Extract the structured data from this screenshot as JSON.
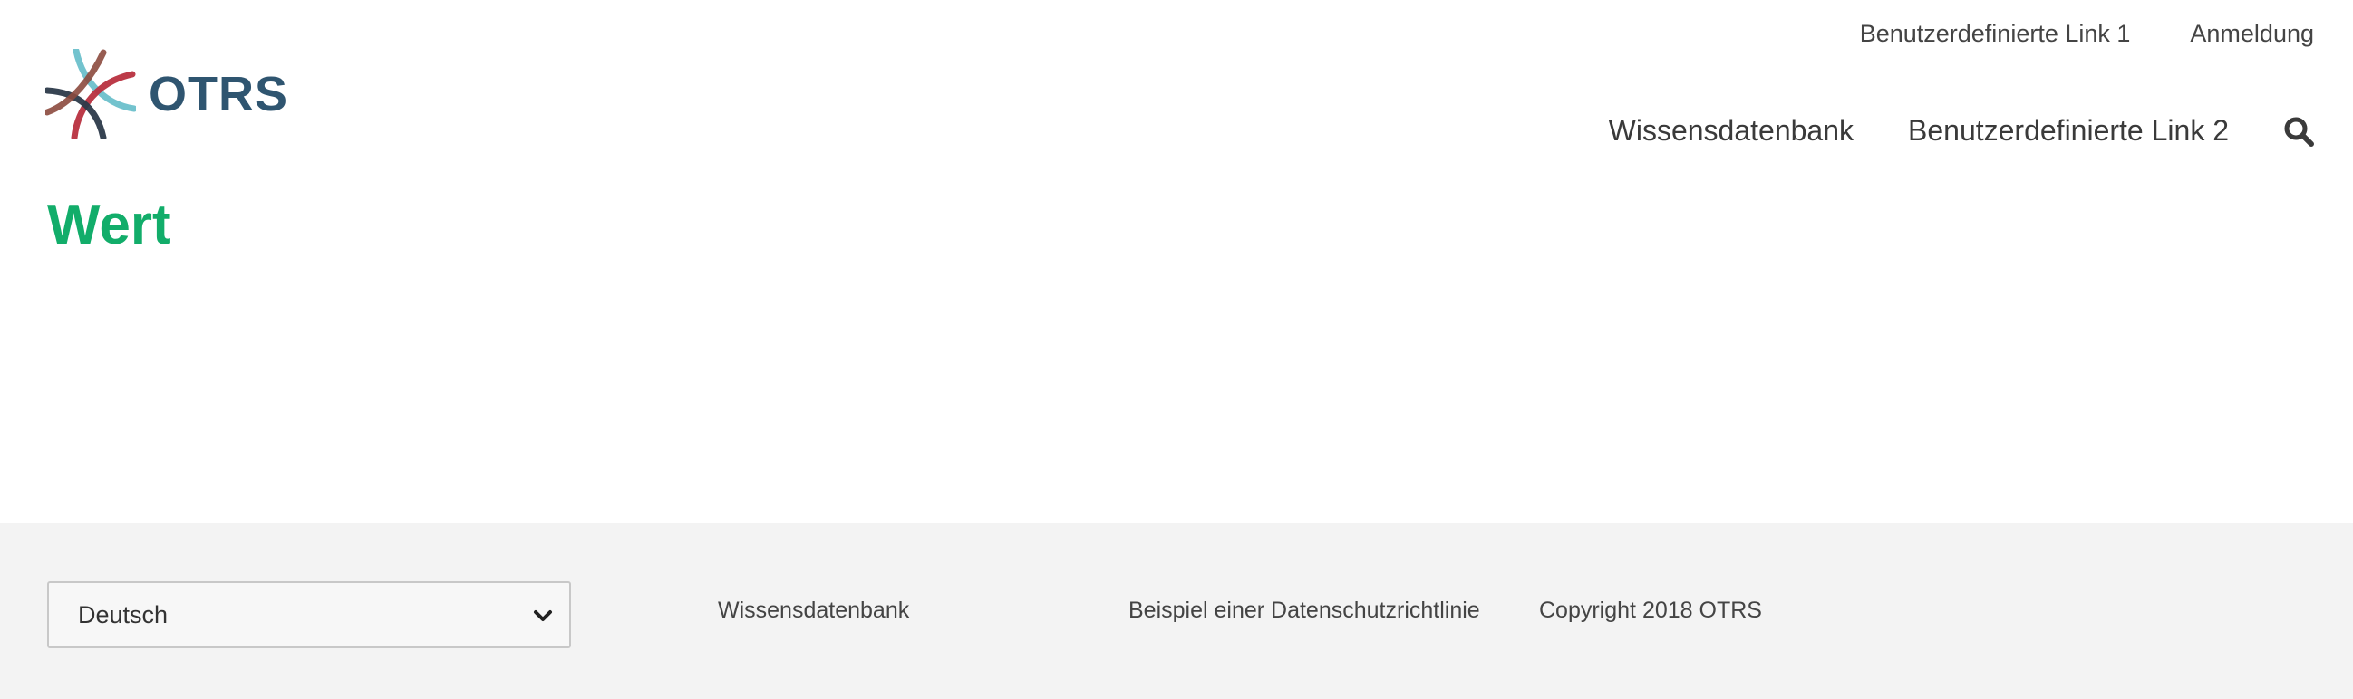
{
  "brand": {
    "name": "OTRS",
    "text_color": "#2f5570",
    "logo_colors": [
      "#6cc0cb",
      "#b8303f",
      "#2c3a4a",
      "#8c4a3e"
    ]
  },
  "header": {
    "top_links": [
      {
        "label": "Benutzerdefinierte Link 1"
      },
      {
        "label": "Anmeldung"
      }
    ],
    "nav": [
      {
        "label": "Wissensdatenbank"
      },
      {
        "label": "Benutzerdefinierte Link 2"
      }
    ],
    "search_icon": "search-icon"
  },
  "main": {
    "title": "Wert",
    "title_color": "#12ad6a"
  },
  "footer": {
    "background": "#f3f3f3",
    "language_select": {
      "value": "Deutsch",
      "icon": "chevron-down-icon"
    },
    "links": [
      {
        "label": "Wissensdatenbank"
      },
      {
        "label": "Beispiel einer Datenschutzrichtlinie"
      }
    ],
    "copyright": "Copyright 2018 OTRS"
  }
}
